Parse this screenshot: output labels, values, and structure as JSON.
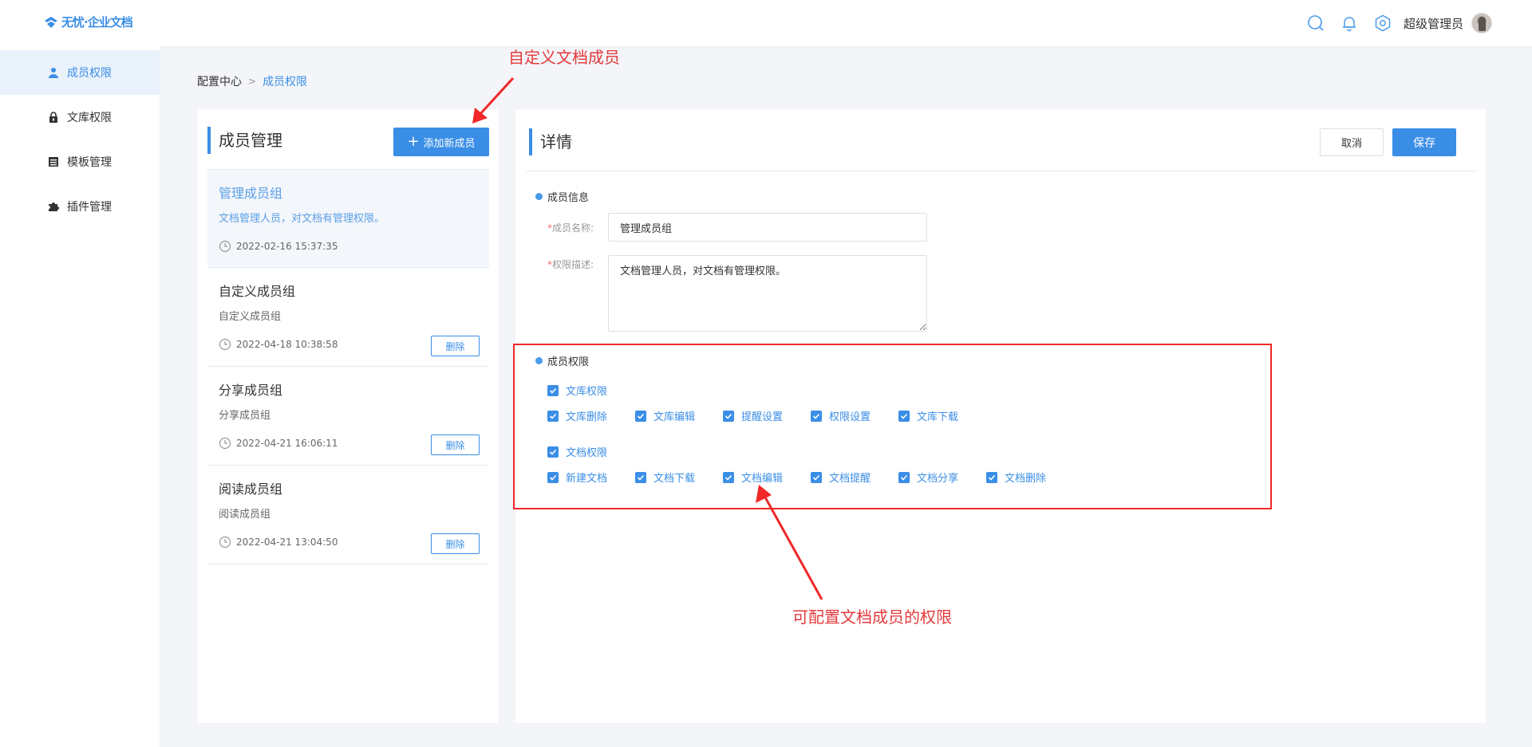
{
  "app": {
    "logo_text": "无忧·企业文档"
  },
  "header": {
    "username": "超级管理员"
  },
  "sidebar": {
    "items": [
      {
        "label": "成员权限",
        "icon": "user-icon",
        "active": true
      },
      {
        "label": "文库权限",
        "icon": "lock-icon",
        "active": false
      },
      {
        "label": "模板管理",
        "icon": "template-icon",
        "active": false
      },
      {
        "label": "插件管理",
        "icon": "puzzle-icon",
        "active": false
      }
    ]
  },
  "breadcrumb": {
    "root": "配置中心",
    "current": "成员权限"
  },
  "members": {
    "title": "成员管理",
    "add_button": "添加新成员",
    "delete_label": "删除",
    "groups": [
      {
        "name": "管理成员组",
        "desc": "文档管理人员，对文档有管理权限。",
        "time": "2022-02-16 15:37:35"
      },
      {
        "name": "自定义成员组",
        "desc": "自定义成员组",
        "time": "2022-04-18 10:38:58"
      },
      {
        "name": "分享成员组",
        "desc": "分享成员组",
        "time": "2022-04-21 16:06:11"
      },
      {
        "name": "阅读成员组",
        "desc": "阅读成员组",
        "time": "2022-04-21 13:04:50"
      }
    ]
  },
  "detail": {
    "title": "详情",
    "cancel": "取消",
    "save": "保存",
    "info_section": "成员信息",
    "name_label": "成员名称:",
    "name_value": "管理成员组",
    "desc_label": "权限描述:",
    "desc_value": "文档管理人员，对文档有管理权限。",
    "perm_section": "成员权限",
    "library_perm": "文库权限",
    "library_items": [
      "文库删除",
      "文库编辑",
      "提醒设置",
      "权限设置",
      "文库下载"
    ],
    "doc_perm": "文档权限",
    "doc_items": [
      "新建文档",
      "文档下载",
      "文档编辑",
      "文档提醒",
      "文档分享",
      "文档删除"
    ]
  },
  "annotations": {
    "custom_member": "自定义文档成员",
    "configure_perm": "可配置文档成员的权限"
  },
  "colors": {
    "accent": "#3a8ee6",
    "annotation": "#e4393c"
  }
}
